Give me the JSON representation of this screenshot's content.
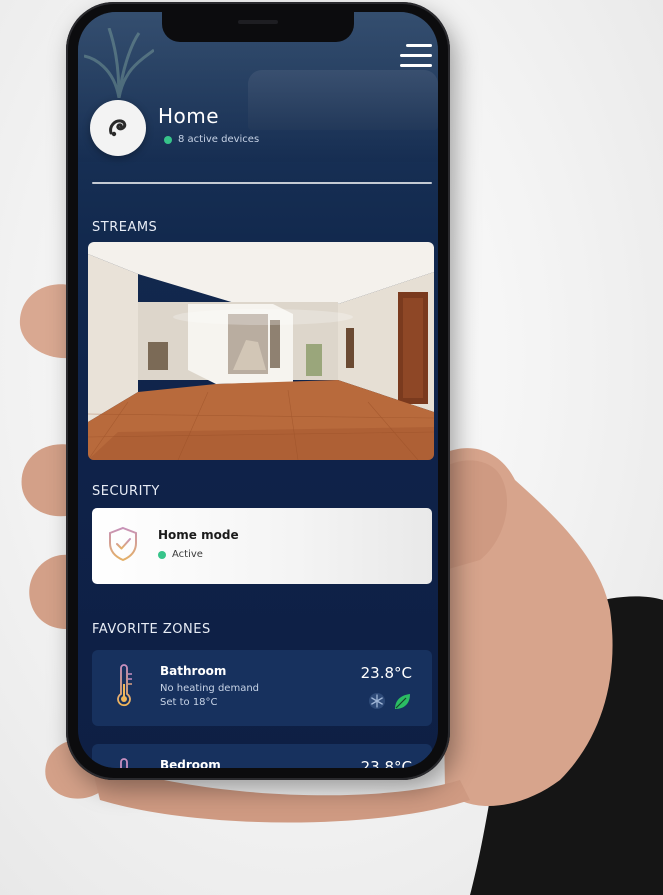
{
  "header": {
    "title": "Home",
    "active_devices": "8 active devices"
  },
  "sections": {
    "streams": "STREAMS",
    "security": "SECURITY",
    "favorite_zones": "FAVORITE ZONES"
  },
  "security": {
    "mode": "Home mode",
    "status": "Active"
  },
  "zones": [
    {
      "name": "Bathroom",
      "line1": "No heating demand",
      "line2": "Set to 18°C",
      "temperature": "23.8°C"
    },
    {
      "name": "Bedroom",
      "temperature": "23.8°C"
    }
  ],
  "colors": {
    "accent_green": "#37c48a",
    "leaf_green": "#2bbd63",
    "background_navy": "#0f2249",
    "card_navy": "#17315e"
  },
  "icons": {
    "menu": "hamburger-menu-icon",
    "avatar": "chameleon-logo-icon",
    "security": "shield-check-icon",
    "zone": "thermometer-icon",
    "cooling": "snowflake-icon",
    "eco": "leaf-icon"
  }
}
